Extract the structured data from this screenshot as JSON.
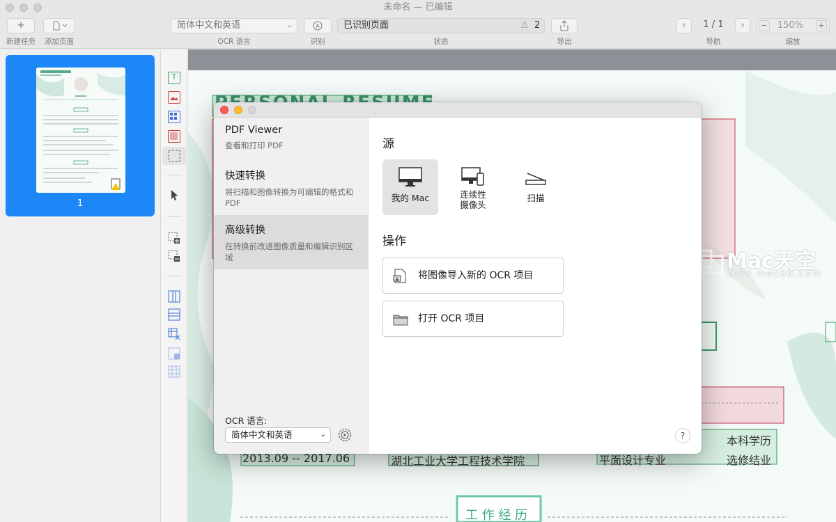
{
  "window": {
    "title": "未命名 — 已编辑"
  },
  "toolbar": {
    "new_task_label": "新建任务",
    "add_page_label": "添加页面",
    "ocr_language_value": "简体中文和英语",
    "ocr_language_label": "OCR 语言",
    "recognize_label": "识别",
    "status_value": "已识别页面",
    "status_count": "2",
    "status_label": "状态",
    "export_label": "导出",
    "page_indicator": "1 / 1",
    "nav_label": "导航",
    "zoom_value": "150%",
    "zoom_label": "缩放"
  },
  "sidebar": {
    "page_number": "1"
  },
  "dialog": {
    "modes": [
      {
        "title": "PDF Viewer",
        "subtitle": "查看和打印 PDF"
      },
      {
        "title": "快速转换",
        "subtitle": "将扫描和图像转换为可编辑的格式和 PDF"
      },
      {
        "title": "高级转换",
        "subtitle": "在转换前改进图像质量和编辑识别区域"
      }
    ],
    "source_heading": "源",
    "sources": [
      {
        "label": "我的 Mac",
        "icon": "imac-icon"
      },
      {
        "label": "连续性\n摄像头",
        "icon": "continuity-camera-icon"
      },
      {
        "label": "扫描",
        "icon": "scanner-icon"
      }
    ],
    "actions_heading": "操作",
    "actions": [
      {
        "label": "将图像导入新的 OCR 项目",
        "icon": "import-image-icon"
      },
      {
        "label": "打开 OCR 项目",
        "icon": "folder-icon"
      }
    ],
    "ocr_language_label": "OCR 语言:",
    "ocr_language_value": "简体中文和英语",
    "help_label": "?"
  },
  "document": {
    "heading": "PERSONAL RESUME",
    "date_range": "2013.09 -- 2017.06",
    "university": "湖北工业大学工程技术学院",
    "major": "平面设计专业",
    "degree": "本科学历",
    "course": "选修结业",
    "work_section": "工 作 经 历"
  },
  "watermark": {
    "brand": "Mac天空",
    "url": "www.mac69.com"
  }
}
